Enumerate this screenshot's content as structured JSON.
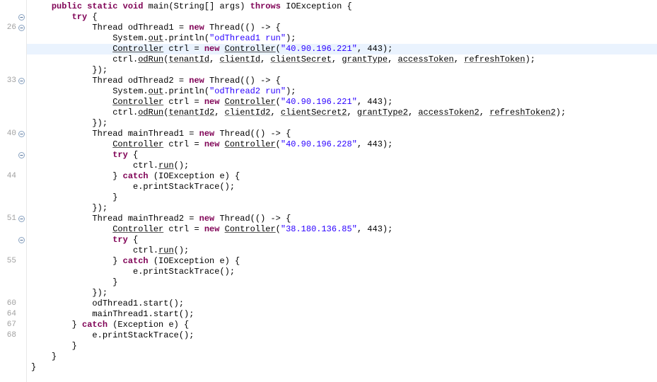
{
  "gutter": [
    {
      "num": "",
      "fold": ""
    },
    {
      "num": "",
      "fold": "minus"
    },
    {
      "num": "26",
      "fold": "minus"
    },
    {
      "num": "",
      "fold": ""
    },
    {
      "num": "",
      "fold": ""
    },
    {
      "num": "",
      "fold": ""
    },
    {
      "num": "",
      "fold": ""
    },
    {
      "num": "33",
      "fold": "minus"
    },
    {
      "num": "",
      "fold": ""
    },
    {
      "num": "",
      "fold": ""
    },
    {
      "num": "",
      "fold": ""
    },
    {
      "num": "",
      "fold": ""
    },
    {
      "num": "40",
      "fold": "minus"
    },
    {
      "num": "",
      "fold": ""
    },
    {
      "num": "",
      "fold": "minus"
    },
    {
      "num": "",
      "fold": ""
    },
    {
      "num": "44",
      "fold": ""
    },
    {
      "num": "",
      "fold": ""
    },
    {
      "num": "",
      "fold": ""
    },
    {
      "num": "",
      "fold": ""
    },
    {
      "num": "51",
      "fold": "minus"
    },
    {
      "num": "",
      "fold": ""
    },
    {
      "num": "",
      "fold": "minus"
    },
    {
      "num": "",
      "fold": ""
    },
    {
      "num": "55",
      "fold": ""
    },
    {
      "num": "",
      "fold": ""
    },
    {
      "num": "",
      "fold": ""
    },
    {
      "num": "",
      "fold": ""
    },
    {
      "num": "60",
      "fold": ""
    },
    {
      "num": "64",
      "fold": ""
    },
    {
      "num": "67",
      "fold": ""
    },
    {
      "num": "68",
      "fold": ""
    },
    {
      "num": "",
      "fold": ""
    },
    {
      "num": "",
      "fold": ""
    },
    {
      "num": "",
      "fold": ""
    }
  ],
  "code": {
    "l0": {
      "indent": "    ",
      "tokens": [
        {
          "t": "public",
          "c": "kw"
        },
        {
          "t": " ",
          "c": "plain"
        },
        {
          "t": "static",
          "c": "kw"
        },
        {
          "t": " ",
          "c": "plain"
        },
        {
          "t": "void",
          "c": "kw"
        },
        {
          "t": " ",
          "c": "plain"
        },
        {
          "t": "main(String[] args) ",
          "c": "plain"
        },
        {
          "t": "throws",
          "c": "kw"
        },
        {
          "t": " IOException {",
          "c": "plain"
        }
      ]
    },
    "l1": {
      "indent": "        ",
      "tokens": [
        {
          "t": "try",
          "c": "kw"
        },
        {
          "t": " {",
          "c": "plain"
        }
      ]
    },
    "l2": {
      "indent": "            ",
      "tokens": [
        {
          "t": "Thread odThread1 = ",
          "c": "plain"
        },
        {
          "t": "new",
          "c": "kw"
        },
        {
          "t": " Thread(() -> {",
          "c": "plain"
        }
      ]
    },
    "l3": {
      "indent": "                ",
      "tokens": [
        {
          "t": "System.",
          "c": "plain"
        },
        {
          "t": "out",
          "c": "var-underline"
        },
        {
          "t": ".println(",
          "c": "plain"
        },
        {
          "t": "\"odThread1 run\"",
          "c": "str"
        },
        {
          "t": ");",
          "c": "plain"
        }
      ]
    },
    "l4": {
      "indent": "                ",
      "tokens": [
        {
          "t": "Controller",
          "c": "method-underline"
        },
        {
          "t": " ctrl = ",
          "c": "plain"
        },
        {
          "t": "new",
          "c": "kw"
        },
        {
          "t": " ",
          "c": "plain"
        },
        {
          "t": "Controller",
          "c": "method-underline"
        },
        {
          "t": "(",
          "c": "plain"
        },
        {
          "t": "\"40.90.196.221\"",
          "c": "str"
        },
        {
          "t": ", 443);",
          "c": "plain"
        }
      ],
      "hl": true
    },
    "l5": {
      "indent": "                ",
      "tokens": [
        {
          "t": "ctrl.",
          "c": "plain"
        },
        {
          "t": "odRun",
          "c": "method-underline"
        },
        {
          "t": "(",
          "c": "plain"
        },
        {
          "t": "tenantId",
          "c": "var-underline"
        },
        {
          "t": ", ",
          "c": "plain"
        },
        {
          "t": "clientId",
          "c": "var-underline"
        },
        {
          "t": ", ",
          "c": "plain"
        },
        {
          "t": "clientSecret",
          "c": "var-underline"
        },
        {
          "t": ", ",
          "c": "plain"
        },
        {
          "t": "grantType",
          "c": "var-underline"
        },
        {
          "t": ", ",
          "c": "plain"
        },
        {
          "t": "accessToken",
          "c": "var-underline"
        },
        {
          "t": ", ",
          "c": "plain"
        },
        {
          "t": "refreshToken",
          "c": "var-underline"
        },
        {
          "t": ");",
          "c": "plain"
        }
      ]
    },
    "l6": {
      "indent": "            ",
      "tokens": [
        {
          "t": "});",
          "c": "plain"
        }
      ]
    },
    "l7": {
      "indent": "            ",
      "tokens": [
        {
          "t": "Thread odThread2 = ",
          "c": "plain"
        },
        {
          "t": "new",
          "c": "kw"
        },
        {
          "t": " Thread(() -> {",
          "c": "plain"
        }
      ]
    },
    "l8": {
      "indent": "                ",
      "tokens": [
        {
          "t": "System.",
          "c": "plain"
        },
        {
          "t": "out",
          "c": "var-underline"
        },
        {
          "t": ".println(",
          "c": "plain"
        },
        {
          "t": "\"odThread2 run\"",
          "c": "str"
        },
        {
          "t": ");",
          "c": "plain"
        }
      ]
    },
    "l9": {
      "indent": "                ",
      "tokens": [
        {
          "t": "Controller",
          "c": "method-underline"
        },
        {
          "t": " ctrl = ",
          "c": "plain"
        },
        {
          "t": "new",
          "c": "kw"
        },
        {
          "t": " ",
          "c": "plain"
        },
        {
          "t": "Controller",
          "c": "method-underline"
        },
        {
          "t": "(",
          "c": "plain"
        },
        {
          "t": "\"40.90.196.221\"",
          "c": "str"
        },
        {
          "t": ", 443);",
          "c": "plain"
        }
      ]
    },
    "l10": {
      "indent": "                ",
      "tokens": [
        {
          "t": "ctrl.",
          "c": "plain"
        },
        {
          "t": "odRun",
          "c": "method-underline"
        },
        {
          "t": "(",
          "c": "plain"
        },
        {
          "t": "tenantId2",
          "c": "var-underline"
        },
        {
          "t": ", ",
          "c": "plain"
        },
        {
          "t": "clientId2",
          "c": "var-underline"
        },
        {
          "t": ", ",
          "c": "plain"
        },
        {
          "t": "clientSecret2",
          "c": "var-underline"
        },
        {
          "t": ", ",
          "c": "plain"
        },
        {
          "t": "grantType2",
          "c": "var-underline"
        },
        {
          "t": ", ",
          "c": "plain"
        },
        {
          "t": "accessToken2",
          "c": "var-underline"
        },
        {
          "t": ", ",
          "c": "plain"
        },
        {
          "t": "refreshToken2",
          "c": "var-underline"
        },
        {
          "t": ");",
          "c": "plain"
        }
      ]
    },
    "l11": {
      "indent": "            ",
      "tokens": [
        {
          "t": "});",
          "c": "plain"
        }
      ]
    },
    "l12": {
      "indent": "            ",
      "tokens": [
        {
          "t": "Thread mainThread1 = ",
          "c": "plain"
        },
        {
          "t": "new",
          "c": "kw"
        },
        {
          "t": " Thread(() -> {",
          "c": "plain"
        }
      ]
    },
    "l13": {
      "indent": "                ",
      "tokens": [
        {
          "t": "Controller",
          "c": "method-underline"
        },
        {
          "t": " ctrl = ",
          "c": "plain"
        },
        {
          "t": "new",
          "c": "kw"
        },
        {
          "t": " ",
          "c": "plain"
        },
        {
          "t": "Controller",
          "c": "method-underline"
        },
        {
          "t": "(",
          "c": "plain"
        },
        {
          "t": "\"40.90.196.228\"",
          "c": "str"
        },
        {
          "t": ", 443);",
          "c": "plain"
        }
      ]
    },
    "l14": {
      "indent": "                ",
      "tokens": [
        {
          "t": "try",
          "c": "kw"
        },
        {
          "t": " {",
          "c": "plain"
        }
      ]
    },
    "l15": {
      "indent": "                    ",
      "tokens": [
        {
          "t": "ctrl.",
          "c": "plain"
        },
        {
          "t": "run",
          "c": "method-underline"
        },
        {
          "t": "();",
          "c": "plain"
        }
      ]
    },
    "l16": {
      "indent": "                ",
      "tokens": [
        {
          "t": "} ",
          "c": "plain"
        },
        {
          "t": "catch",
          "c": "kw"
        },
        {
          "t": " (IOException e) {",
          "c": "plain"
        }
      ]
    },
    "l17": {
      "indent": "                    ",
      "tokens": [
        {
          "t": "e.printStackTrace();",
          "c": "plain"
        }
      ]
    },
    "l18": {
      "indent": "                ",
      "tokens": [
        {
          "t": "}",
          "c": "plain"
        }
      ]
    },
    "l19": {
      "indent": "            ",
      "tokens": [
        {
          "t": "});",
          "c": "plain"
        }
      ]
    },
    "l20": {
      "indent": "            ",
      "tokens": [
        {
          "t": "Thread mainThread2 = ",
          "c": "plain"
        },
        {
          "t": "new",
          "c": "kw"
        },
        {
          "t": " Thread(() -> {",
          "c": "plain"
        }
      ]
    },
    "l21": {
      "indent": "                ",
      "tokens": [
        {
          "t": "Controller",
          "c": "method-underline"
        },
        {
          "t": " ctrl = ",
          "c": "plain"
        },
        {
          "t": "new",
          "c": "kw"
        },
        {
          "t": " ",
          "c": "plain"
        },
        {
          "t": "Controller",
          "c": "method-underline"
        },
        {
          "t": "(",
          "c": "plain"
        },
        {
          "t": "\"38.180.136.85\"",
          "c": "str"
        },
        {
          "t": ", 443);",
          "c": "plain"
        }
      ]
    },
    "l22": {
      "indent": "                ",
      "tokens": [
        {
          "t": "try",
          "c": "kw"
        },
        {
          "t": " {",
          "c": "plain"
        }
      ]
    },
    "l23": {
      "indent": "                    ",
      "tokens": [
        {
          "t": "ctrl.",
          "c": "plain"
        },
        {
          "t": "run",
          "c": "method-underline"
        },
        {
          "t": "();",
          "c": "plain"
        }
      ]
    },
    "l24": {
      "indent": "                ",
      "tokens": [
        {
          "t": "} ",
          "c": "plain"
        },
        {
          "t": "catch",
          "c": "kw"
        },
        {
          "t": " (IOException e) {",
          "c": "plain"
        }
      ]
    },
    "l25": {
      "indent": "                    ",
      "tokens": [
        {
          "t": "e.printStackTrace();",
          "c": "plain"
        }
      ]
    },
    "l26": {
      "indent": "                ",
      "tokens": [
        {
          "t": "}",
          "c": "plain"
        }
      ]
    },
    "l27": {
      "indent": "            ",
      "tokens": [
        {
          "t": "});",
          "c": "plain"
        }
      ]
    },
    "l28": {
      "indent": "            ",
      "tokens": [
        {
          "t": "odThread1.start();",
          "c": "plain"
        }
      ]
    },
    "l29": {
      "indent": "            ",
      "tokens": [
        {
          "t": "mainThread1.start();",
          "c": "plain"
        }
      ]
    },
    "l30": {
      "indent": "        ",
      "tokens": [
        {
          "t": "} ",
          "c": "plain"
        },
        {
          "t": "catch",
          "c": "kw"
        },
        {
          "t": " (Exception e) {",
          "c": "plain"
        }
      ]
    },
    "l31": {
      "indent": "            ",
      "tokens": [
        {
          "t": "e.printStackTrace();",
          "c": "plain"
        }
      ]
    },
    "l32": {
      "indent": "        ",
      "tokens": [
        {
          "t": "}",
          "c": "plain"
        }
      ]
    },
    "l33": {
      "indent": "    ",
      "tokens": [
        {
          "t": "}",
          "c": "plain"
        }
      ]
    },
    "l34": {
      "indent": "",
      "tokens": [
        {
          "t": "}",
          "c": "plain"
        }
      ]
    }
  }
}
